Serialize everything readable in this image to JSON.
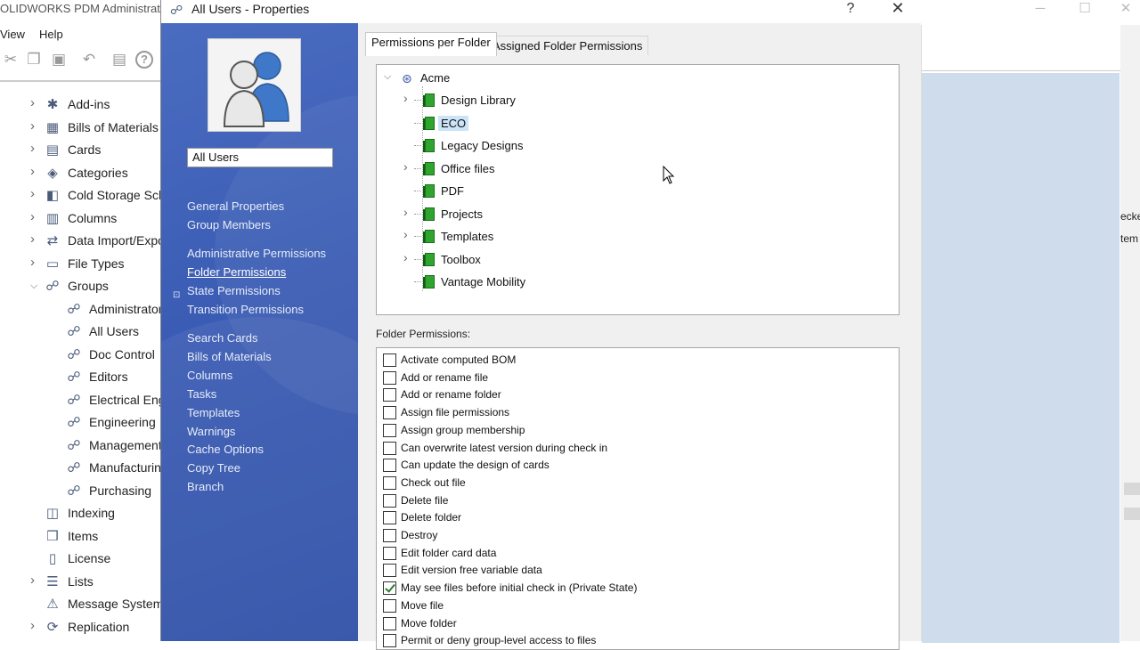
{
  "app": {
    "title": "OLIDWORKS PDM Administrat",
    "menu": [
      "View",
      "Help"
    ],
    "tree": [
      {
        "label": "Add-ins",
        "icon": "puzzle-icon",
        "glyph": "✱",
        "expandable": true
      },
      {
        "label": "Bills of Materials",
        "icon": "table-icon",
        "glyph": "▦",
        "expandable": true
      },
      {
        "label": "Cards",
        "icon": "card-icon",
        "glyph": "▤",
        "expandable": true
      },
      {
        "label": "Categories",
        "icon": "categories-icon",
        "glyph": "◈",
        "expandable": true
      },
      {
        "label": "Cold Storage Sch",
        "icon": "cold-storage-icon",
        "glyph": "◧",
        "expandable": true
      },
      {
        "label": "Columns",
        "icon": "columns-icon",
        "glyph": "▥",
        "expandable": true
      },
      {
        "label": "Data Import/Expo",
        "icon": "data-import-icon",
        "glyph": "⇄",
        "expandable": true
      },
      {
        "label": "File Types",
        "icon": "file-types-icon",
        "glyph": "▭",
        "expandable": true
      },
      {
        "label": "Groups",
        "icon": "groups-icon",
        "glyph": "☍",
        "expandable": true,
        "expanded": true
      },
      {
        "label": "Administrator",
        "icon": "group-icon",
        "glyph": "☍",
        "child": true
      },
      {
        "label": "All Users",
        "icon": "group-icon",
        "glyph": "☍",
        "child": true
      },
      {
        "label": "Doc Control",
        "icon": "group-icon",
        "glyph": "☍",
        "child": true
      },
      {
        "label": "Editors",
        "icon": "group-icon",
        "glyph": "☍",
        "child": true
      },
      {
        "label": "Electrical Eng",
        "icon": "group-icon",
        "glyph": "☍",
        "child": true
      },
      {
        "label": "Engineering",
        "icon": "group-icon",
        "glyph": "☍",
        "child": true
      },
      {
        "label": "Management",
        "icon": "group-icon",
        "glyph": "☍",
        "child": true
      },
      {
        "label": "Manufacturin",
        "icon": "group-icon",
        "glyph": "☍",
        "child": true
      },
      {
        "label": "Purchasing",
        "icon": "group-icon",
        "glyph": "☍",
        "child": true
      },
      {
        "label": "Indexing",
        "icon": "indexing-icon",
        "glyph": "◫",
        "expandable": false
      },
      {
        "label": "Items",
        "icon": "items-icon",
        "glyph": "❒",
        "expandable": false
      },
      {
        "label": "License",
        "icon": "license-icon",
        "glyph": "▯",
        "expandable": false
      },
      {
        "label": "Lists",
        "icon": "lists-icon",
        "glyph": "☰",
        "expandable": true
      },
      {
        "label": "Message System",
        "icon": "message-icon",
        "glyph": "⚠",
        "expandable": false
      },
      {
        "label": "Replication",
        "icon": "replication-icon",
        "glyph": "⟳",
        "expandable": true
      }
    ],
    "right_strip": [
      "ecke",
      "tem"
    ]
  },
  "dialog": {
    "title": "All Users - Properties",
    "help_glyph": "?",
    "close_glyph": "✕",
    "group_name": "All Users",
    "nav_groups": [
      [
        "General Properties",
        "Group Members"
      ],
      [
        "Administrative Permissions",
        "Folder Permissions",
        "State Permissions",
        "Transition Permissions"
      ],
      [
        "Search Cards",
        "Bills of Materials",
        "Columns",
        "Tasks",
        "Templates",
        "Warnings",
        "Cache Options",
        "Copy Tree",
        "Branch"
      ]
    ],
    "active_nav": "Folder Permissions",
    "tabs": [
      "Permissions per Folder",
      "Assigned Folder Permissions"
    ],
    "active_tab": 0,
    "tree_root": "Acme",
    "folders": [
      {
        "label": "Design Library",
        "expandable": true
      },
      {
        "label": "ECO",
        "expandable": false,
        "selected": true
      },
      {
        "label": "Legacy Designs",
        "expandable": false
      },
      {
        "label": "Office files",
        "expandable": true
      },
      {
        "label": "PDF",
        "expandable": false
      },
      {
        "label": "Projects",
        "expandable": true
      },
      {
        "label": "Templates",
        "expandable": true
      },
      {
        "label": "Toolbox",
        "expandable": true
      },
      {
        "label": "Vantage Mobility",
        "expandable": false
      }
    ],
    "permissions_title": "Folder Permissions:",
    "permissions": [
      {
        "label": "Activate computed BOM",
        "checked": false
      },
      {
        "label": "Add or rename file",
        "checked": false
      },
      {
        "label": "Add or rename folder",
        "checked": false
      },
      {
        "label": "Assign file permissions",
        "checked": false
      },
      {
        "label": "Assign group membership",
        "checked": false
      },
      {
        "label": "Can overwrite latest version during check in",
        "checked": false
      },
      {
        "label": "Can update the design of cards",
        "checked": false
      },
      {
        "label": "Check out file",
        "checked": false
      },
      {
        "label": "Delete file",
        "checked": false
      },
      {
        "label": "Delete folder",
        "checked": false
      },
      {
        "label": "Destroy",
        "checked": false
      },
      {
        "label": "Edit folder card data",
        "checked": false
      },
      {
        "label": "Edit version free variable data",
        "checked": false
      },
      {
        "label": "May see files before initial check in (Private State)",
        "checked": true
      },
      {
        "label": "Move file",
        "checked": false
      },
      {
        "label": "Move folder",
        "checked": false
      },
      {
        "label": "Permit or deny group-level access to files",
        "checked": false
      }
    ]
  }
}
